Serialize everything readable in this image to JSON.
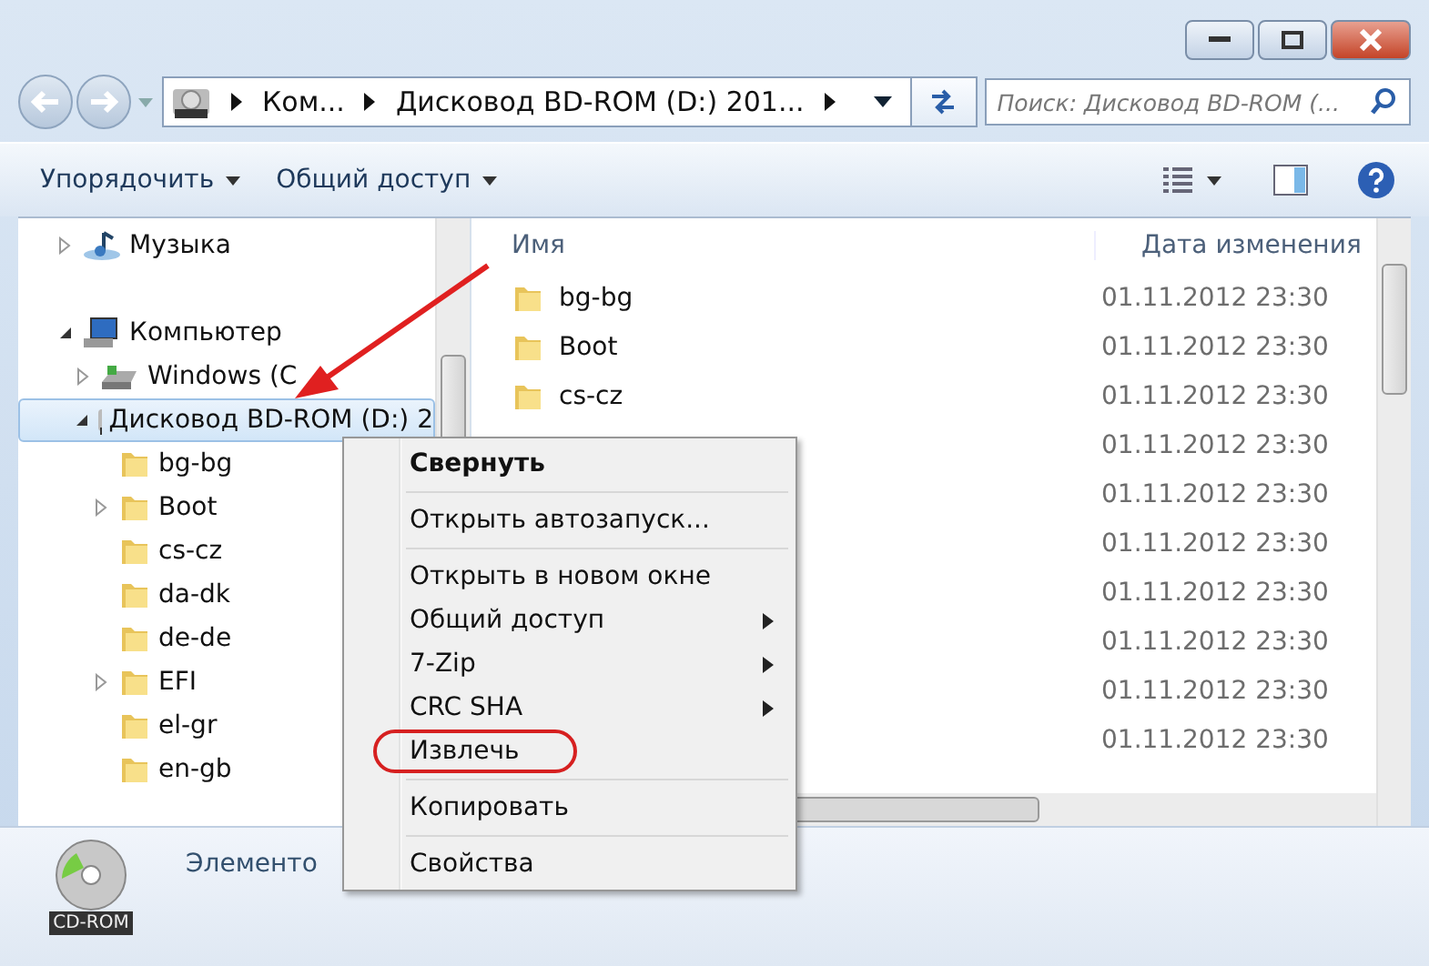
{
  "address": {
    "segments": [
      "Ком...",
      "Дисковод BD-ROM (D:) 201..."
    ]
  },
  "search": {
    "placeholder": "Поиск: Дисковод BD-ROM (..."
  },
  "toolbar": {
    "buttons": [
      "Упорядочить",
      "Общий доступ"
    ]
  },
  "nav": {
    "items": [
      {
        "label": "Музыка",
        "kind": "music",
        "expanded": false,
        "selected": false
      },
      {
        "label": "Компьютер",
        "kind": "computer",
        "expanded": true,
        "selected": false,
        "children": [
          {
            "label": "Windows (C",
            "kind": "drive",
            "expanded": false,
            "selected": false
          },
          {
            "label": "Дисковод BD-ROM (D:) 2",
            "kind": "cdrom",
            "expanded": true,
            "selected": true,
            "children": [
              {
                "label": "bg-bg",
                "kind": "folder",
                "selected": false
              },
              {
                "label": "Boot",
                "kind": "folder",
                "expanded": false,
                "selected": false
              },
              {
                "label": "cs-cz",
                "kind": "folder",
                "selected": false
              },
              {
                "label": "da-dk",
                "kind": "folder",
                "selected": false
              },
              {
                "label": "de-de",
                "kind": "folder",
                "selected": false
              },
              {
                "label": "EFI",
                "kind": "folder",
                "expanded": false,
                "selected": false
              },
              {
                "label": "el-gr",
                "kind": "folder",
                "selected": false
              },
              {
                "label": "en-gb",
                "kind": "folder",
                "selected": false
              }
            ]
          }
        ]
      }
    ]
  },
  "files": {
    "columns": [
      "Имя",
      "Дата изменения"
    ],
    "rows": [
      {
        "name": "bg-bg",
        "date": "01.11.2012 23:30"
      },
      {
        "name": "Boot",
        "date": "01.11.2012 23:30"
      },
      {
        "name": "cs-cz",
        "date": "01.11.2012 23:30"
      },
      {
        "date": "01.11.2012 23:30"
      },
      {
        "date": "01.11.2012 23:30"
      },
      {
        "date": "01.11.2012 23:30"
      },
      {
        "date": "01.11.2012 23:30"
      },
      {
        "date": "01.11.2012 23:30"
      },
      {
        "date": "01.11.2012 23:30"
      },
      {
        "date": "01.11.2012 23:30"
      }
    ]
  },
  "details": {
    "icon_label": "CD-ROM",
    "text": "Элементо"
  },
  "context_menu": {
    "items": [
      {
        "kind": "item",
        "label": "Свернуть",
        "bold": true,
        "submenu": false,
        "circled": false
      },
      {
        "kind": "separator"
      },
      {
        "kind": "item",
        "label": "Открыть автозапуск...",
        "bold": false,
        "submenu": false,
        "circled": false
      },
      {
        "kind": "separator"
      },
      {
        "kind": "item",
        "label": "Открыть в новом окне",
        "bold": false,
        "submenu": false,
        "circled": false
      },
      {
        "kind": "item",
        "label": "Общий доступ",
        "bold": false,
        "submenu": true,
        "circled": false
      },
      {
        "kind": "item",
        "label": "7-Zip",
        "bold": false,
        "submenu": true,
        "circled": false
      },
      {
        "kind": "item",
        "label": "CRC SHA",
        "bold": false,
        "submenu": true,
        "circled": false
      },
      {
        "kind": "item",
        "label": "Извлечь",
        "bold": false,
        "submenu": false,
        "circled": true
      },
      {
        "kind": "separator"
      },
      {
        "kind": "item",
        "label": "Копировать",
        "bold": false,
        "submenu": false,
        "circled": false
      },
      {
        "kind": "separator"
      },
      {
        "kind": "item",
        "label": "Свойства",
        "bold": false,
        "submenu": false,
        "circled": false
      }
    ]
  }
}
